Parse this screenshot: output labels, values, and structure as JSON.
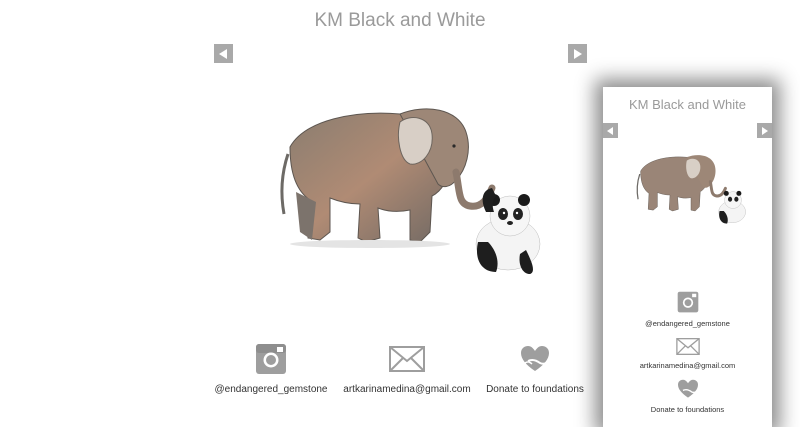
{
  "site": {
    "title": "KM Black and White"
  },
  "gallery": {
    "prev_icon": "chevron-left-icon",
    "next_icon": "chevron-right-icon",
    "current_image": "elephant-and-panda-illustration"
  },
  "contacts": [
    {
      "icon": "instagram-icon",
      "label": "@endangered_gemstone"
    },
    {
      "icon": "mail-icon",
      "label": "artkarinamedina@gmail.com"
    },
    {
      "icon": "heart-hands-icon",
      "label": "Donate to foundations"
    }
  ],
  "mobile_preview": {
    "title": "KM Black and White",
    "contacts": [
      {
        "label": "@endangered_gemstone"
      },
      {
        "label": "artkarinamedina@gmail.com"
      },
      {
        "label": "Donate to foundations"
      }
    ]
  },
  "colors": {
    "title": "#9a9a9a",
    "arrow_bg": "#a9a9a9",
    "icon_gray": "#9e9e9e"
  }
}
